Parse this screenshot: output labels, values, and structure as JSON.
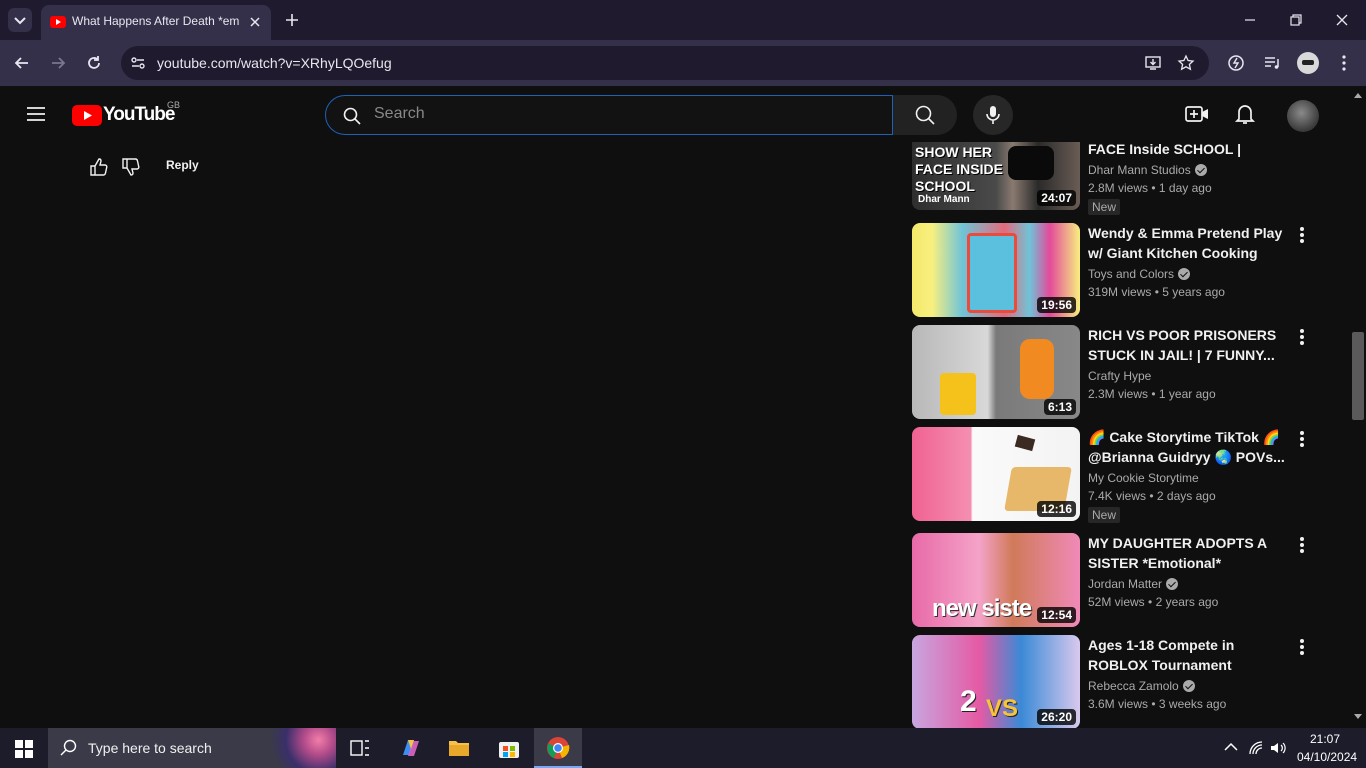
{
  "browser": {
    "tab_title": "What Happens After Death *em",
    "url": "youtube.com/watch?v=XRhyLQOefug"
  },
  "youtube": {
    "logo_text": "YouTube",
    "region": "GB",
    "search_placeholder": "Search"
  },
  "comment": {
    "reply_label": "Reply"
  },
  "sidebar": {
    "videos": [
      {
        "title": "FACE Inside SCHOOL | Dhar...",
        "channel": "Dhar Mann Studios",
        "verified": true,
        "views": "2.8M views",
        "age": "1 day ago",
        "badge": "New",
        "duration": "24:07",
        "thumb_text": "SHOW HER FACE INSIDE SCHOOL",
        "thumb_brand": "Dhar Mann"
      },
      {
        "title": "Wendy & Emma Pretend Play w/ Giant Kitchen Cooking Toy...",
        "channel": "Toys and Colors",
        "verified": true,
        "views": "319M views",
        "age": "5 years ago",
        "badge": "",
        "duration": "19:56"
      },
      {
        "title": "RICH VS POOR PRISONERS STUCK IN JAIL! | 7 FUNNY...",
        "channel": "Crafty Hype",
        "verified": false,
        "views": "2.3M views",
        "age": "1 year ago",
        "badge": "",
        "duration": "6:13"
      },
      {
        "title": "🌈 Cake Storytime TikTok 🌈 @Brianna Guidryy 🌏 POVs...",
        "channel": "My Cookie Storytime",
        "verified": false,
        "views": "7.4K views",
        "age": "2 days ago",
        "badge": "New",
        "duration": "12:16"
      },
      {
        "title": "MY DAUGHTER ADOPTS A SISTER *Emotional*",
        "channel": "Jordan Matter",
        "verified": true,
        "views": "52M views",
        "age": "2 years ago",
        "badge": "",
        "duration": "12:54",
        "thumb_text": "new siste"
      },
      {
        "title": "Ages 1-18 Compete in ROBLOX Tournament",
        "channel": "Rebecca Zamolo",
        "verified": true,
        "views": "3.6M views",
        "age": "3 weeks ago",
        "badge": "",
        "duration": "26:20"
      }
    ]
  },
  "taskbar": {
    "search_label": "Type here to search",
    "time": "21:07",
    "date": "04/10/2024"
  },
  "colors": {
    "chrome_dark": "#1f1a2e",
    "chrome_toolbar": "#35304a",
    "yt_bg": "#0f0f0f",
    "yt_red": "#ff0000"
  }
}
